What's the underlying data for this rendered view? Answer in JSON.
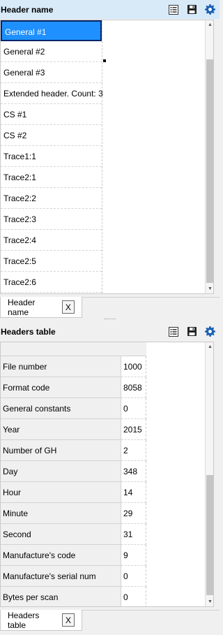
{
  "top_panel": {
    "title": "Header name",
    "toolbar": {
      "view_icon": "list-view-icon",
      "save_icon": "save-icon",
      "settings_icon": "gear-icon"
    },
    "items": [
      "General #1",
      "General #2",
      "General #3",
      "Extended header. Count: 3",
      "CS #1",
      "CS #2",
      "Trace1:1",
      "Trace2:1",
      "Trace2:2",
      "Trace2:3",
      "Trace2:4",
      "Trace2:5",
      "Trace2:6"
    ],
    "selected_index": 0,
    "tab_label": "Header name",
    "tab_close": "X"
  },
  "bottom_panel": {
    "title": "Headers table",
    "toolbar": {
      "view_icon": "list-view-icon",
      "save_icon": "save-icon",
      "settings_icon": "gear-icon"
    },
    "rows": [
      {
        "key": "File number",
        "value": "1000"
      },
      {
        "key": "Format code",
        "value": "8058"
      },
      {
        "key": "General constants",
        "value": "0"
      },
      {
        "key": "Year",
        "value": "2015"
      },
      {
        "key": "Number of GH",
        "value": "2"
      },
      {
        "key": "Day",
        "value": "348"
      },
      {
        "key": "Hour",
        "value": "14"
      },
      {
        "key": "Minute",
        "value": "29"
      },
      {
        "key": "Second",
        "value": "31"
      },
      {
        "key": "Manufacture's code",
        "value": "9"
      },
      {
        "key": "Manufacture's serial num",
        "value": "0"
      },
      {
        "key": "Bytes per scan",
        "value": "0"
      }
    ],
    "tab_label": "Headers table",
    "tab_close": "X"
  },
  "colors": {
    "selection": "#1e90ff",
    "header_bar": "#d8e9f8",
    "gear": "#1a5fb4"
  }
}
